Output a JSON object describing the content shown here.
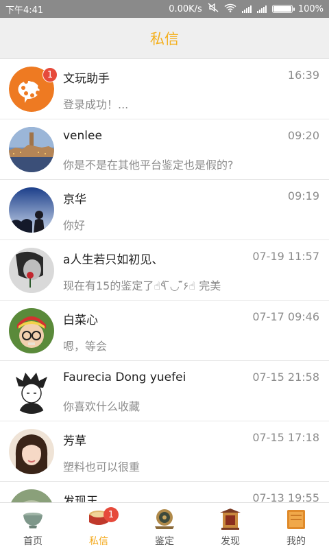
{
  "status_bar": {
    "time": "下午4:41",
    "network_speed": "0.00K/s",
    "battery": "100%"
  },
  "header": {
    "title": "私信"
  },
  "conversations": [
    {
      "name": "文玩助手",
      "time": "16:39",
      "preview": "登录成功！...",
      "badge": "1"
    },
    {
      "name": "venlee",
      "time": "09:20",
      "preview": "你是不是在其他平台鉴定也是假的?"
    },
    {
      "name": "京华",
      "time": "09:19",
      "preview": "你好"
    },
    {
      "name": "a人生若只如初见、",
      "time": "07-19 11:57",
      "preview": "现在有15的鉴定了☝٩̋ ̄◡ ̄̋۶☝ 完美"
    },
    {
      "name": "白菜心",
      "time": "07-17 09:46",
      "preview": "嗯，等会"
    },
    {
      "name": "Faurecia Dong yuefei",
      "time": "07-15 21:58",
      "preview": "你喜欢什么收藏"
    },
    {
      "name": "芳草",
      "time": "07-15 17:18",
      "preview": "塑料也可以很重"
    },
    {
      "name": "发现王",
      "time": "07-13 19:55",
      "preview": ""
    }
  ],
  "tabs": [
    {
      "label": "首页",
      "icon": "bowl-icon"
    },
    {
      "label": "私信",
      "icon": "drum-icon",
      "badge": "1",
      "active": true
    },
    {
      "label": "鉴定",
      "icon": "mirror-icon"
    },
    {
      "label": "发现",
      "icon": "shrine-icon"
    },
    {
      "label": "我的",
      "icon": "box-icon"
    }
  ],
  "colors": {
    "accent": "#f4b01f",
    "badge": "#e64a3b",
    "status_bar": "#8a8a8a",
    "header_bg": "#efefef"
  }
}
